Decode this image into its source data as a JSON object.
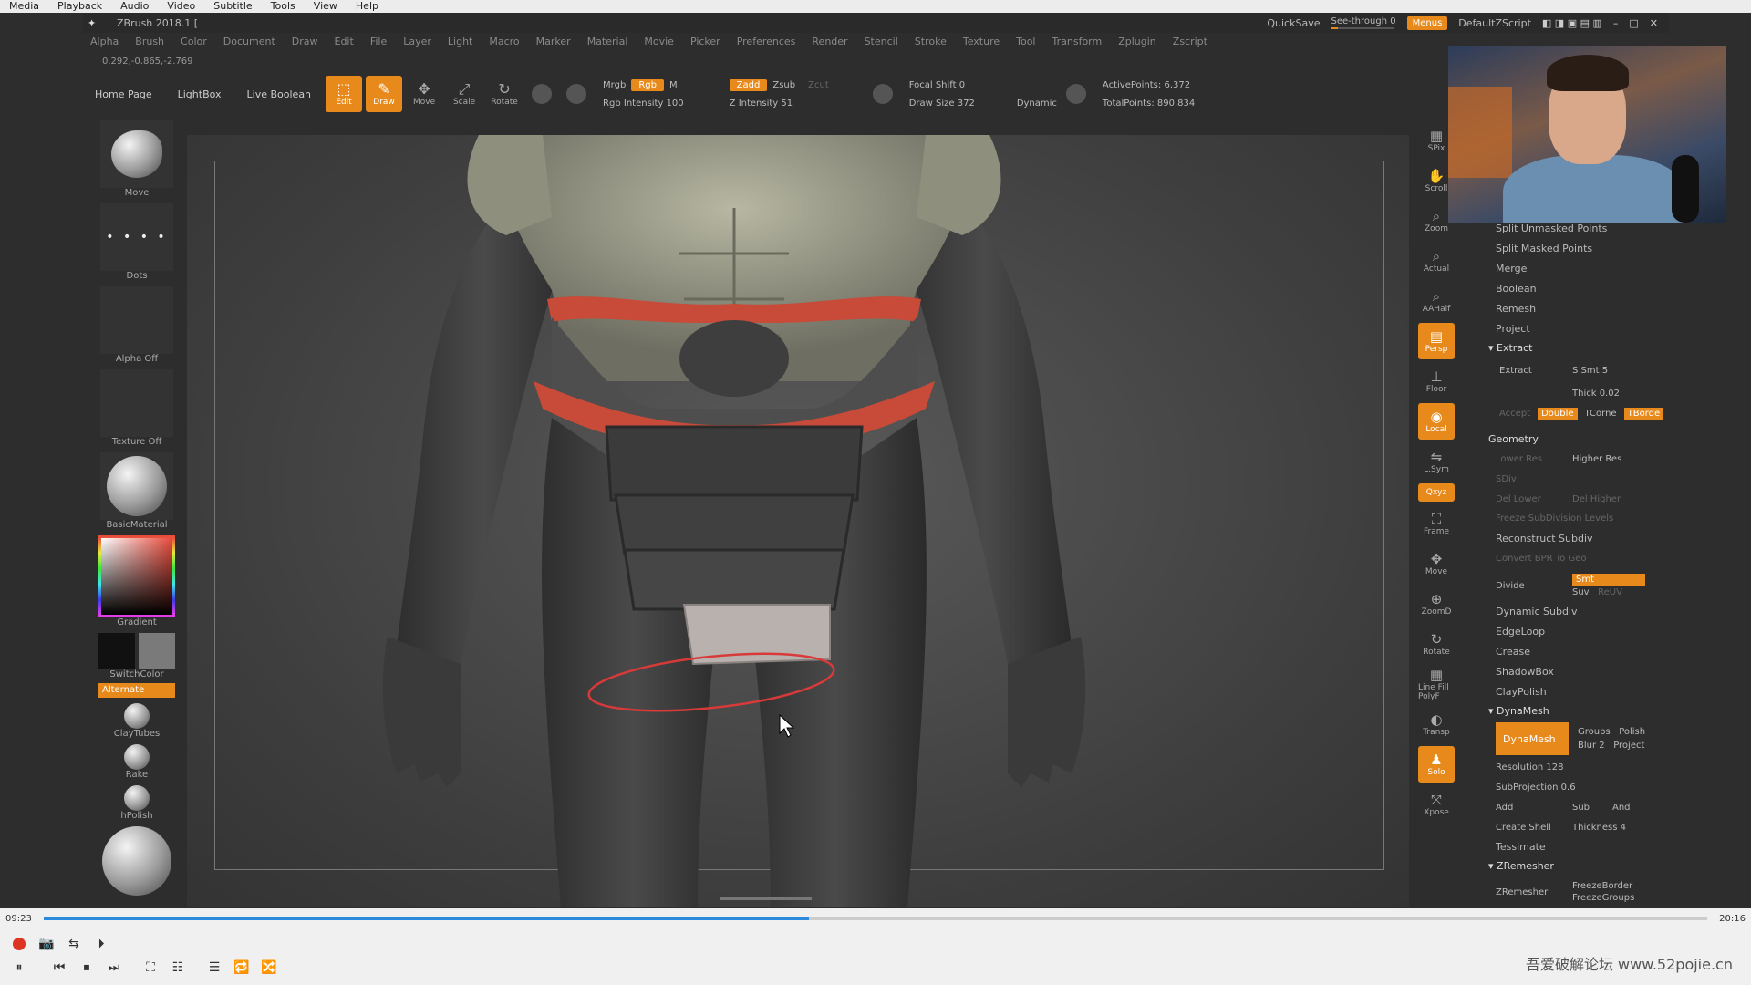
{
  "vlc_menu": [
    "Media",
    "Playback",
    "Audio",
    "Video",
    "Subtitle",
    "Tools",
    "View",
    "Help"
  ],
  "zbrush": {
    "app_title": "ZBrush 2018.1 [",
    "quicksave": "QuickSave",
    "see_through": "See-through",
    "see_through_value": "0",
    "menus_btn": "Menus",
    "script": "DefaultZScript",
    "menus": [
      "Alpha",
      "Brush",
      "Color",
      "Document",
      "Draw",
      "Edit",
      "File",
      "Layer",
      "Light",
      "Macro",
      "Marker",
      "Material",
      "Movie",
      "Picker",
      "Preferences",
      "Render",
      "Stencil",
      "Stroke",
      "Texture",
      "Tool",
      "Transform",
      "Zplugin",
      "Zscript"
    ],
    "coords": "0.292,-0.865,-2.769",
    "toolbar": {
      "home_page": "Home Page",
      "lightbox": "LightBox",
      "live_boolean": "Live Boolean",
      "edit": "Edit",
      "draw": "Draw",
      "move": "Move",
      "scale": "Scale",
      "rotate": "Rotate",
      "mrgb": "Mrgb",
      "rgb": "Rgb",
      "m": "M",
      "rgb_intensity": "Rgb Intensity 100",
      "zadd": "Zadd",
      "zsub": "Zsub",
      "zcut": "Zcut",
      "z_intensity": "Z Intensity 51",
      "focal_shift": "Focal Shift 0",
      "draw_size": "Draw Size 372",
      "dynamic": "Dynamic",
      "active_points": "ActivePoints: 6,372",
      "total_points": "TotalPoints: 890,834"
    },
    "left_shelf": {
      "brush": "Move",
      "stroke": "Dots",
      "alpha": "Alpha Off",
      "texture": "Texture Off",
      "material": "BasicMaterial",
      "gradient": "Gradient",
      "switch_color": "SwitchColor",
      "alternate": "Alternate",
      "b1": "ClayTubes",
      "b2": "Rake",
      "b3": "hPolish"
    },
    "right_icons": [
      "SPix",
      "Scroll",
      "Zoom",
      "Actual",
      "AAHalf",
      "Persp",
      "Floor",
      "Local",
      "L.Sym",
      "Qxyz",
      "Frame",
      "Move",
      "ZoomD",
      "Rotate",
      "Line Fill PolyF",
      "Transp",
      "Solo",
      "Xpose"
    ],
    "right_panel": {
      "top_items": [
        "Split Unmasked Points",
        "Split Masked Points",
        "Merge",
        "Boolean",
        "Remesh",
        "Project"
      ],
      "extract_section": "Extract",
      "extract_btn": "Extract",
      "s_smt": "S Smt 5",
      "thick": "Thick 0.02",
      "accept": "Accept",
      "double": "Double",
      "tcorne": "TCorne",
      "tborder": "TBorde",
      "geometry_section": "Geometry",
      "lower_res": "Lower Res",
      "higher_res": "Higher Res",
      "sdiv": "SDiv",
      "del_lower": "Del Lower",
      "del_higher": "Del Higher",
      "freeze": "Freeze SubDivision Levels",
      "reconstruct": "Reconstruct Subdiv",
      "convert_bpr": "Convert BPR To Geo",
      "divide": "Divide",
      "smt": "Smt",
      "suv": "Suv",
      "rsmt": "ReUV",
      "geo_items": [
        "Dynamic Subdiv",
        "EdgeLoop",
        "Crease",
        "ShadowBox",
        "ClayPolish"
      ],
      "dynamesh_section": "DynaMesh",
      "dynamesh_btn": "DynaMesh",
      "groups": "Groups",
      "polish": "Polish",
      "blur": "Blur 2",
      "project": "Project",
      "resolution": "Resolution 128",
      "subprojection": "SubProjection 0.6",
      "add": "Add",
      "sub": "Sub",
      "and": "And",
      "create_shell": "Create Shell",
      "thickness": "Thickness 4",
      "tessimate": "Tessimate",
      "zremesher_section": "ZRemesher",
      "zremesher_btn": "ZRemesher",
      "freeze_border": "FreezeBorder",
      "freeze_groups": "FreezeGroups"
    }
  },
  "vlc_controls": {
    "time_elapsed": "09:23",
    "time_total": "20:16",
    "progress": 0.46,
    "watermark": "吾爱破解论坛  www.52pojie.cn"
  },
  "colors": {
    "accent": "#e8891b",
    "vlc_progress": "#2b8adb",
    "mask_red": "#c84a38"
  }
}
